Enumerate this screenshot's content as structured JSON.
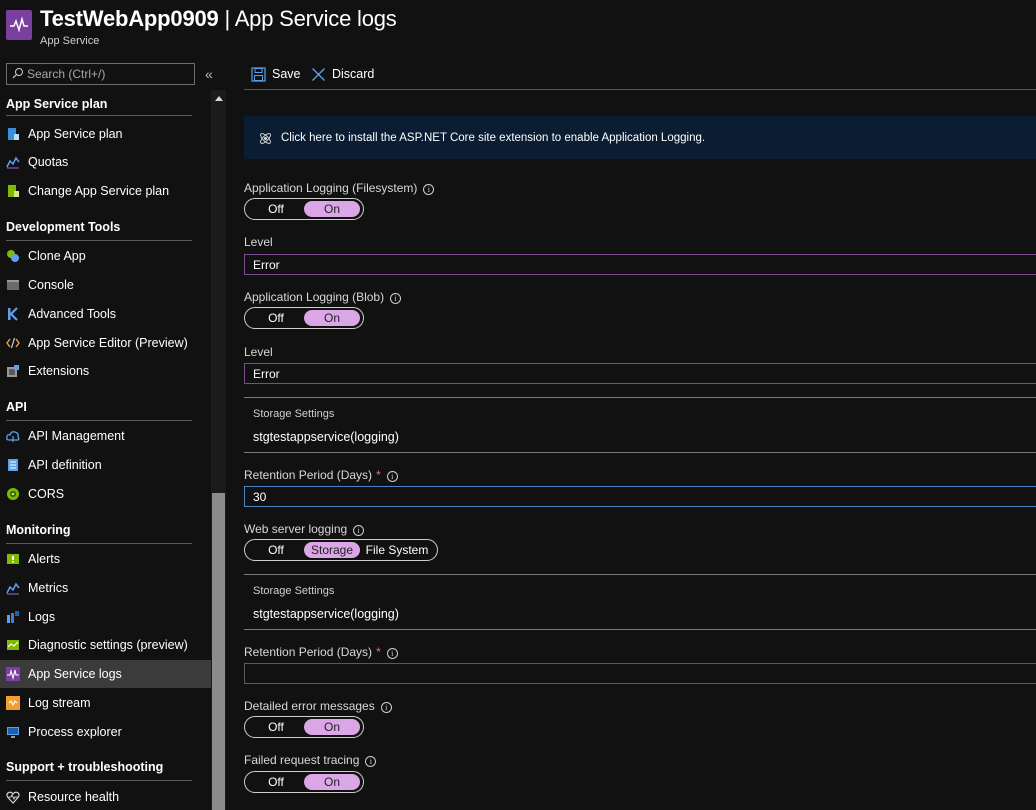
{
  "header": {
    "title_bold": "TestWebApp0909",
    "title_rest": " | App Service logs",
    "subtitle": "App Service",
    "accent": "#7b3fa0"
  },
  "search": {
    "placeholder": "Search (Ctrl+/)"
  },
  "sidebar": {
    "collapse_glyph": "«",
    "sections": [
      {
        "title": "App Service plan",
        "items": [
          {
            "label": "App Service plan",
            "icon": "app-service-plan-icon"
          },
          {
            "label": "Quotas",
            "icon": "quotas-icon"
          },
          {
            "label": "Change App Service plan",
            "icon": "change-plan-icon"
          }
        ]
      },
      {
        "title": "Development Tools",
        "items": [
          {
            "label": "Clone App",
            "icon": "clone-app-icon"
          },
          {
            "label": "Console",
            "icon": "console-icon"
          },
          {
            "label": "Advanced Tools",
            "icon": "advanced-tools-icon"
          },
          {
            "label": "App Service Editor (Preview)",
            "icon": "code-editor-icon"
          },
          {
            "label": "Extensions",
            "icon": "extensions-icon"
          }
        ]
      },
      {
        "title": "API",
        "items": [
          {
            "label": "API Management",
            "icon": "api-management-icon"
          },
          {
            "label": "API definition",
            "icon": "api-definition-icon"
          },
          {
            "label": "CORS",
            "icon": "cors-icon"
          }
        ]
      },
      {
        "title": "Monitoring",
        "items": [
          {
            "label": "Alerts",
            "icon": "alerts-icon"
          },
          {
            "label": "Metrics",
            "icon": "metrics-icon"
          },
          {
            "label": "Logs",
            "icon": "logs-icon"
          },
          {
            "label": "Diagnostic settings (preview)",
            "icon": "diagnostic-settings-icon"
          },
          {
            "label": "App Service logs",
            "icon": "app-service-logs-icon",
            "active": true
          },
          {
            "label": "Log stream",
            "icon": "log-stream-icon"
          },
          {
            "label": "Process explorer",
            "icon": "process-explorer-icon"
          }
        ]
      },
      {
        "title": "Support + troubleshooting",
        "items": [
          {
            "label": "Resource health",
            "icon": "resource-health-icon"
          }
        ]
      }
    ]
  },
  "toolbar": {
    "save_label": "Save",
    "discard_label": "Discard"
  },
  "banner": {
    "text": "Click here to install the ASP.NET Core site extension to enable Application Logging."
  },
  "form": {
    "app_logging_fs": {
      "label": "Application Logging (Filesystem)",
      "options": [
        "Off",
        "On"
      ],
      "selected": "On"
    },
    "level_fs": {
      "label": "Level",
      "value": "Error"
    },
    "app_logging_blob": {
      "label": "Application Logging (Blob)",
      "options": [
        "Off",
        "On"
      ],
      "selected": "On"
    },
    "level_blob": {
      "label": "Level",
      "value": "Error"
    },
    "storage_blob": {
      "label": "Storage Settings",
      "value": "stgtestappservice(logging)"
    },
    "retention_blob": {
      "label": "Retention Period (Days)",
      "required": "*",
      "value": "30"
    },
    "web_server_logging": {
      "label": "Web server logging",
      "options": [
        "Off",
        "Storage",
        "File System"
      ],
      "selected": "Storage"
    },
    "storage_web": {
      "label": "Storage Settings",
      "value": "stgtestappservice(logging)"
    },
    "retention_web": {
      "label": "Retention Period (Days)",
      "required": "*",
      "value": ""
    },
    "detailed_errors": {
      "label": "Detailed error messages",
      "options": [
        "Off",
        "On"
      ],
      "selected": "On"
    },
    "failed_request": {
      "label": "Failed request tracing",
      "options": [
        "Off",
        "On"
      ],
      "selected": "On"
    }
  },
  "info_glyph": "i"
}
